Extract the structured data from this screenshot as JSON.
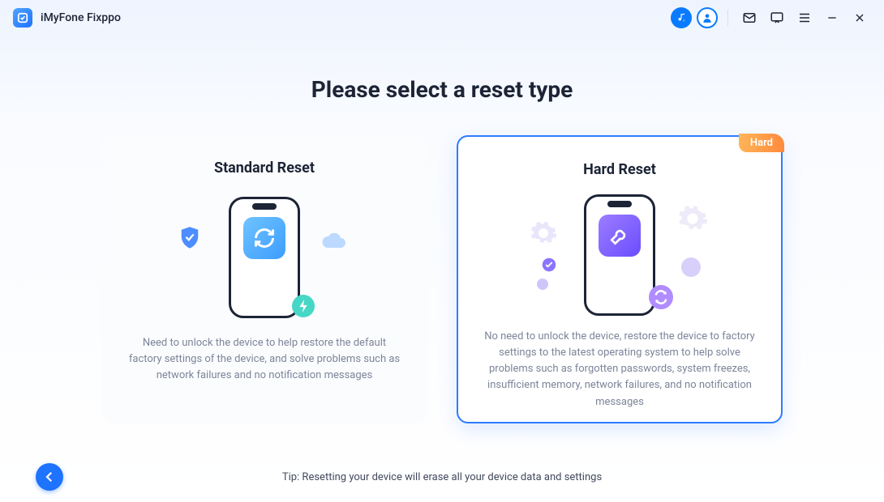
{
  "app": {
    "title": "iMyFone Fixppo"
  },
  "heading": "Please select a reset type",
  "cards": {
    "standard": {
      "title": "Standard Reset",
      "description": "Need to unlock the device to help restore the default factory settings of the device, and solve problems such as network failures and no notification messages"
    },
    "hard": {
      "title": "Hard Reset",
      "badge": "Hard",
      "description": "No need to unlock the device, restore the device to factory settings to the latest operating system to help solve problems such as forgotten passwords, system freezes, insufficient memory, network failures, and no notification messages"
    }
  },
  "footer": {
    "tip": "Tip: Resetting your device will erase all your device data and settings"
  }
}
